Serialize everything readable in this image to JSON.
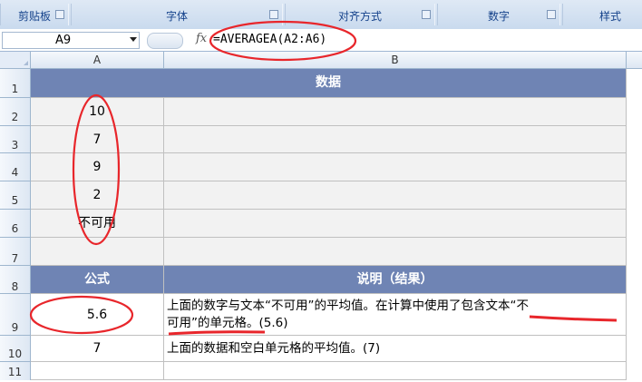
{
  "ribbon": {
    "groups": [
      {
        "label": "剪贴板"
      },
      {
        "label": "字体"
      },
      {
        "label": "对齐方式"
      },
      {
        "label": "数字"
      },
      {
        "label": "样式"
      }
    ]
  },
  "formula_bar": {
    "name_box": "A9",
    "fx_label": "fx",
    "formula": "=AVERAGEA(A2:A6)"
  },
  "columns": [
    "A",
    "B"
  ],
  "rows": [
    "1",
    "2",
    "3",
    "4",
    "5",
    "6",
    "7",
    "8",
    "9",
    "10",
    "11"
  ],
  "cells": {
    "a1_b1": "数据",
    "a2": "10",
    "a3": "7",
    "a4": "9",
    "a5": "2",
    "a6": "不可用",
    "a8": "公式",
    "b8": "说明（结果）",
    "a9": "5.6",
    "b9_line1": "上面的数字与文本“不可用”的平均值。在计算中使用了包含文本“不",
    "b9_line2": "可用”的单元格。(5.6)",
    "a10": "7",
    "b10": "上面的数据和空白单元格的平均值。(7)"
  },
  "colors": {
    "header_fill": "#6f84b4",
    "cell_fill": "#f2f2f2",
    "annotation": "#e8262b"
  }
}
